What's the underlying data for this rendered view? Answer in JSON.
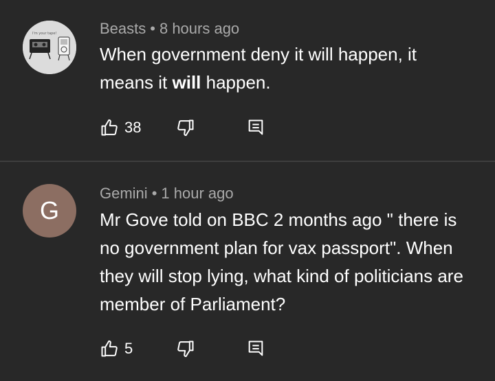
{
  "comments": [
    {
      "author": "Beasts",
      "separator": "•",
      "time": "8 hours ago",
      "text_parts": [
        "When government deny it will happen, it means it ",
        "will",
        " happen."
      ],
      "likes": "38",
      "avatar": {
        "type": "image",
        "description": "cartoon-cassette-and-ipod"
      },
      "icons": {
        "like": "thumbs-up-icon",
        "dislike": "thumbs-down-icon",
        "reply": "reply-comment-icon"
      }
    },
    {
      "author": "Gemini",
      "separator": "•",
      "time": "1 hour ago",
      "text": "Mr Gove told on BBC 2 months ago \" there is no government plan for vax passport\". When they will stop lying, what kind of politicians are member of Parliament?",
      "likes": "5",
      "avatar": {
        "type": "letter",
        "letter": "G",
        "color": "#8c6e62"
      },
      "icons": {
        "like": "thumbs-up-icon",
        "dislike": "thumbs-down-icon",
        "reply": "reply-comment-icon"
      }
    }
  ],
  "colors": {
    "background": "#282828",
    "meta": "#aaaaaa",
    "text": "#ffffff",
    "divider": "#3e3e3e"
  }
}
